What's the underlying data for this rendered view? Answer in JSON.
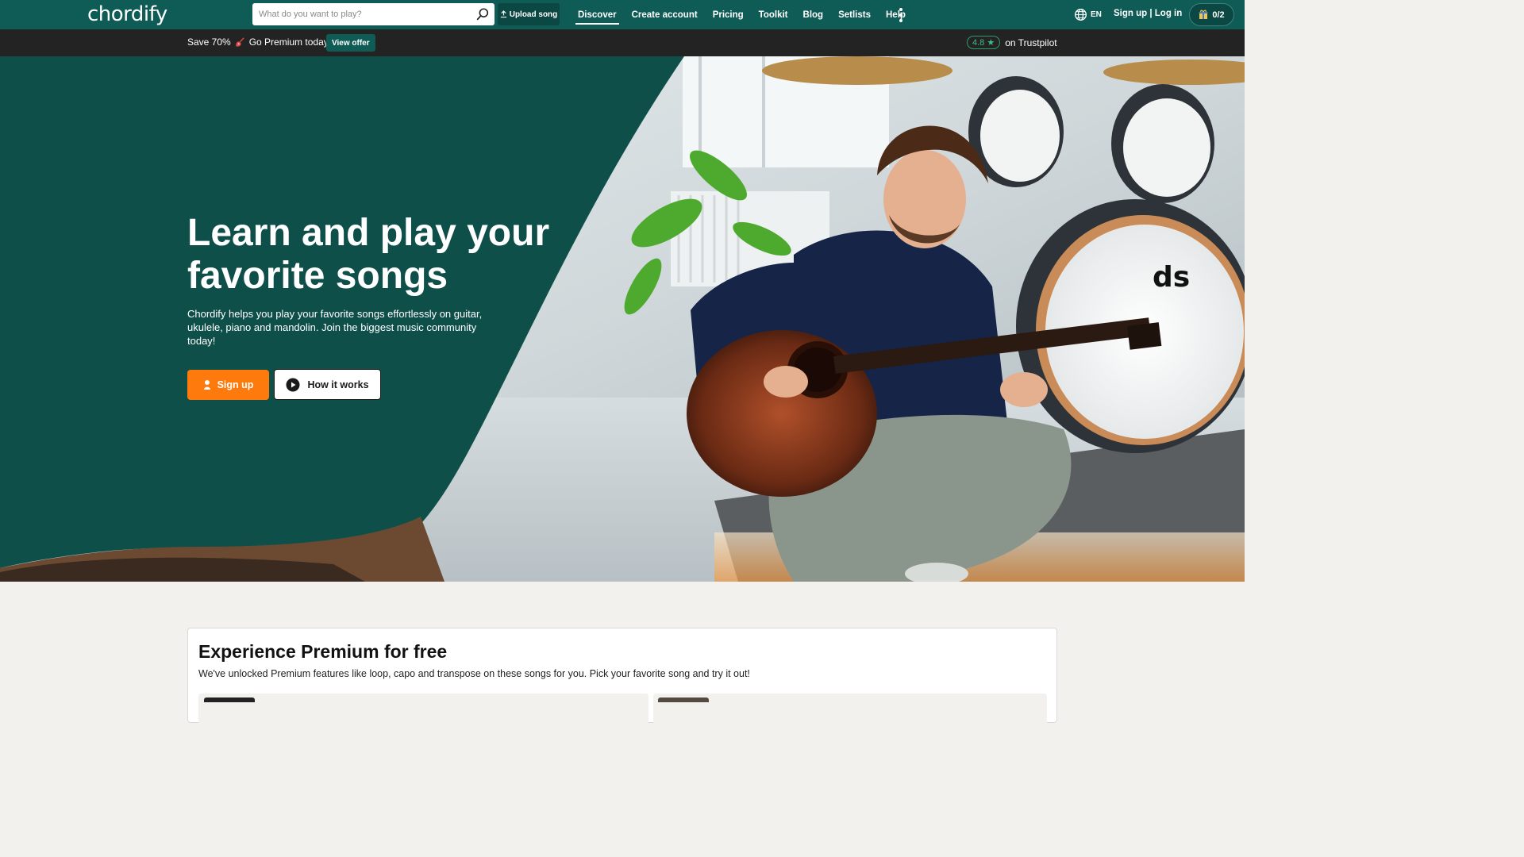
{
  "brand": {
    "logo_text": "chordify",
    "primary": "#0f5c56",
    "accent": "#ff7a0d"
  },
  "topnav": {
    "search_placeholder": "What do you want to play?",
    "search_icon": "search-icon",
    "upload_label": "Upload song",
    "links": [
      "Discover",
      "Create account",
      "Pricing",
      "Toolkit",
      "Blog",
      "Setlists",
      "Help"
    ],
    "active_link": "Discover",
    "language": "EN",
    "auth_label": "Sign up | Log in",
    "gift_count": "0/2"
  },
  "promo": {
    "save_text": "Save 70%",
    "premium_text": "Go Premium today!",
    "offer_label": "View offer",
    "trustpilot_rating": "4.8 ★",
    "trustpilot_text": "on Trustpilot"
  },
  "hero": {
    "title": "Learn and play your favorite songs",
    "subtitle": "Chordify helps you play your favorite songs effortlessly on guitar, ukulele, piano and mandolin. Join the biggest music community today!",
    "signup_label": "Sign up",
    "how_label": "How it works"
  },
  "premium": {
    "title": "Experience Premium for free",
    "description": "We've unlocked Premium features like loop, capo and transpose on these songs for you. Pick your favorite song and try it out!"
  }
}
